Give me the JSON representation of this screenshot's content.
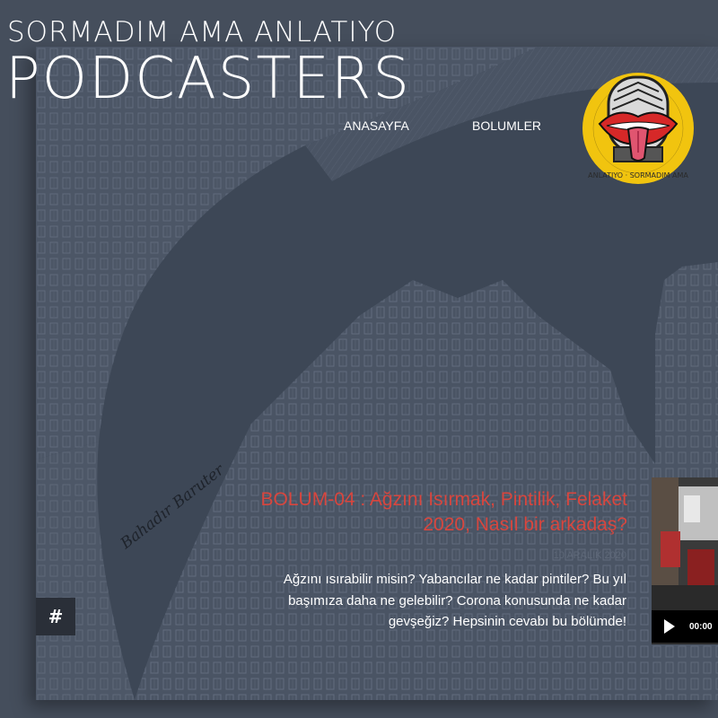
{
  "site": {
    "subtitle": "SORMADIM AMA ANLATIYO",
    "title": "PODCASTERS"
  },
  "nav": {
    "items": [
      {
        "label": "ANASAYFA"
      },
      {
        "label": "BOLUMLER"
      }
    ]
  },
  "logo": {
    "ring_text": "ANLATIYO · SORMADIM AMA",
    "colors": {
      "ring": "#f1c40f",
      "lips": "#d62828"
    }
  },
  "artwork": {
    "signature": "Bahadır Baruter"
  },
  "episode": {
    "title_line1": "BOLUM-04 : Ağzını Isırmak, Pintilik, Felaket",
    "title_line2": "2020, Nasıl bir arkadaş?",
    "date": "10 ARALIK 2020",
    "desc_line1": "Ağzını ısırabilir misin? Yabancılar ne kadar pintiler? Bu yıl",
    "desc_line2": "başımıza daha ne gelebilir? Corona konusunda ne kadar",
    "desc_line3": "gevşeğiz? Hepsinin cevabı bu bölümde!"
  },
  "hash_button": {
    "label": "#"
  },
  "player": {
    "time": "00:00"
  },
  "colors": {
    "accent": "#d8463e",
    "background": "#454e5c",
    "hero": "#3d4756"
  }
}
